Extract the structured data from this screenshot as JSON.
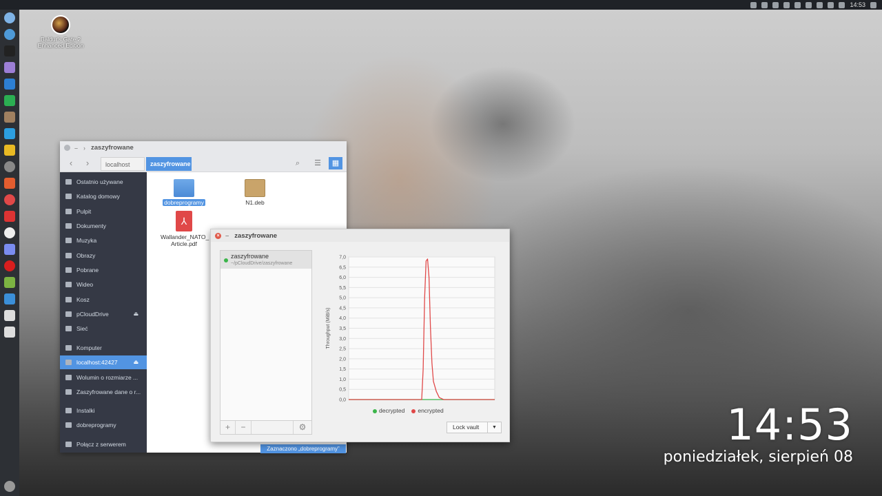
{
  "topbar": {
    "clock": "14:53"
  },
  "desktop": {
    "icon_label_line1": "Baldur's Gate 2",
    "icon_label_line2": "Enhanced Edition"
  },
  "filemanager": {
    "title": "zaszyfrowane",
    "breadcrumb": [
      "localhost (dav)",
      "zaszyfrowane"
    ],
    "sidebar": [
      {
        "label": "Ostatnio używane",
        "icon": "clock-icon"
      },
      {
        "label": "Katalog domowy",
        "icon": "home-icon"
      },
      {
        "label": "Pulpit",
        "icon": "desktop-icon"
      },
      {
        "label": "Dokumenty",
        "icon": "documents-icon"
      },
      {
        "label": "Muzyka",
        "icon": "music-icon"
      },
      {
        "label": "Obrazy",
        "icon": "pictures-icon"
      },
      {
        "label": "Pobrane",
        "icon": "download-icon"
      },
      {
        "label": "Wideo",
        "icon": "video-icon"
      },
      {
        "label": "Kosz",
        "icon": "trash-icon"
      },
      {
        "label": "pCloudDrive",
        "icon": "drive-icon"
      },
      {
        "label": "Sieć",
        "icon": "network-icon"
      },
      {
        "label": "Komputer",
        "icon": "computer-icon"
      },
      {
        "label": "localhost:42427",
        "icon": "network-drive-icon"
      },
      {
        "label": "Wolumin o rozmiarze ...",
        "icon": "drive-icon"
      },
      {
        "label": "Zaszyfrowane dane o r...",
        "icon": "drive-icon"
      },
      {
        "label": "Instalki",
        "icon": "folder-icon"
      },
      {
        "label": "dobreprogramy",
        "icon": "folder-icon"
      },
      {
        "label": "Połącz z serwerem",
        "icon": "server-icon"
      }
    ],
    "files": [
      {
        "name": "dobreprogramy",
        "type": "folder"
      },
      {
        "name": "N1.deb",
        "type": "deb"
      },
      {
        "name": "Wallander_NATO_",
        "name2": "Article.pdf",
        "type": "pdf"
      }
    ],
    "status": "Zaznaczono „dobreprogramy”"
  },
  "vault": {
    "title": "zaszyfrowane",
    "item_name": "zaszyfrowane",
    "item_path": "~/pCloudDrive/zaszyfrowane",
    "add": "+",
    "remove": "−",
    "lock_button": "Lock vault",
    "legend": [
      "decrypted",
      "encrypted"
    ],
    "ylabel": "Throughput (MiB/s)"
  },
  "clock": {
    "time": "14:53",
    "date": "poniedziałek, sierpień 08"
  },
  "colors": {
    "accent": "#5294e2",
    "decrypted": "#3bb54a",
    "encrypted": "#e04848"
  },
  "chart_data": {
    "type": "line",
    "ylabel": "Throughput (MiB/s)",
    "ylim": [
      0,
      7.0
    ],
    "yticks": [
      "7,0",
      "6,5",
      "6,0",
      "5,5",
      "5,0",
      "4,5",
      "4,0",
      "3,5",
      "3,0",
      "2,5",
      "2,0",
      "1,5",
      "1,0",
      "0,5",
      "0,0"
    ],
    "x": [
      0,
      10,
      20,
      30,
      40,
      50,
      51,
      52,
      53,
      54,
      55,
      56,
      57,
      58,
      60,
      62,
      65,
      70,
      80,
      90,
      100
    ],
    "series": [
      {
        "name": "decrypted",
        "values": [
          0,
          0,
          0,
          0,
          0,
          0,
          0,
          0,
          0,
          0,
          0,
          0,
          0,
          0,
          0,
          0,
          0,
          0,
          0,
          0,
          0
        ]
      },
      {
        "name": "encrypted",
        "values": [
          0,
          0,
          0,
          0,
          0,
          0,
          1.5,
          5.0,
          6.8,
          6.9,
          6.0,
          3.5,
          1.8,
          0.9,
          0.4,
          0.1,
          0,
          0,
          0,
          0,
          0
        ]
      }
    ],
    "grid": true
  }
}
